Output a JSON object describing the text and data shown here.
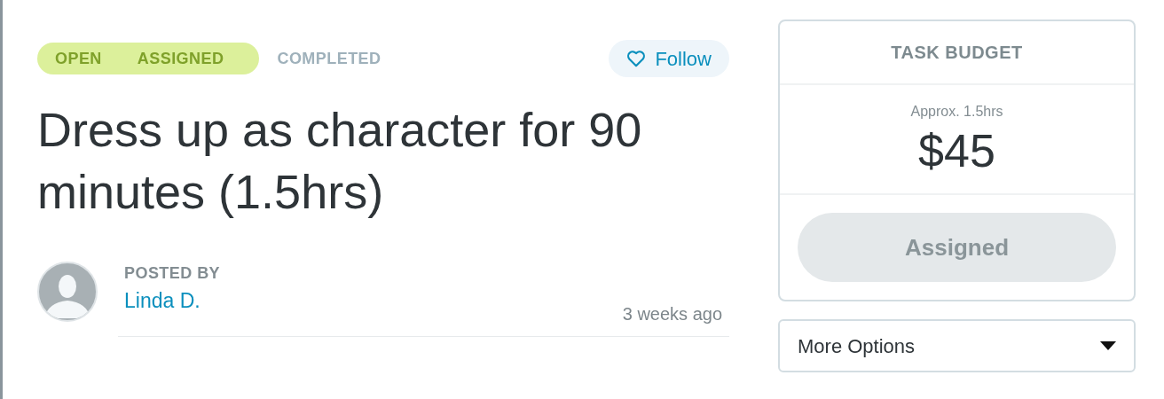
{
  "status_steps": [
    {
      "label": "OPEN",
      "reached": true
    },
    {
      "label": "ASSIGNED",
      "reached": true
    },
    {
      "label": "COMPLETED",
      "reached": false
    }
  ],
  "follow_button": {
    "label": "Follow"
  },
  "task_title": "Dress up as character for 90 minutes (1.5hrs)",
  "poster": {
    "heading": "POSTED BY",
    "name": "Linda D.",
    "posted": "3 weeks ago"
  },
  "budget": {
    "heading": "TASK BUDGET",
    "estimate": "Approx. 1.5hrs",
    "amount": "$45",
    "action": {
      "label": "Assigned",
      "disabled": true
    }
  },
  "more_options": {
    "label": "More Options"
  }
}
